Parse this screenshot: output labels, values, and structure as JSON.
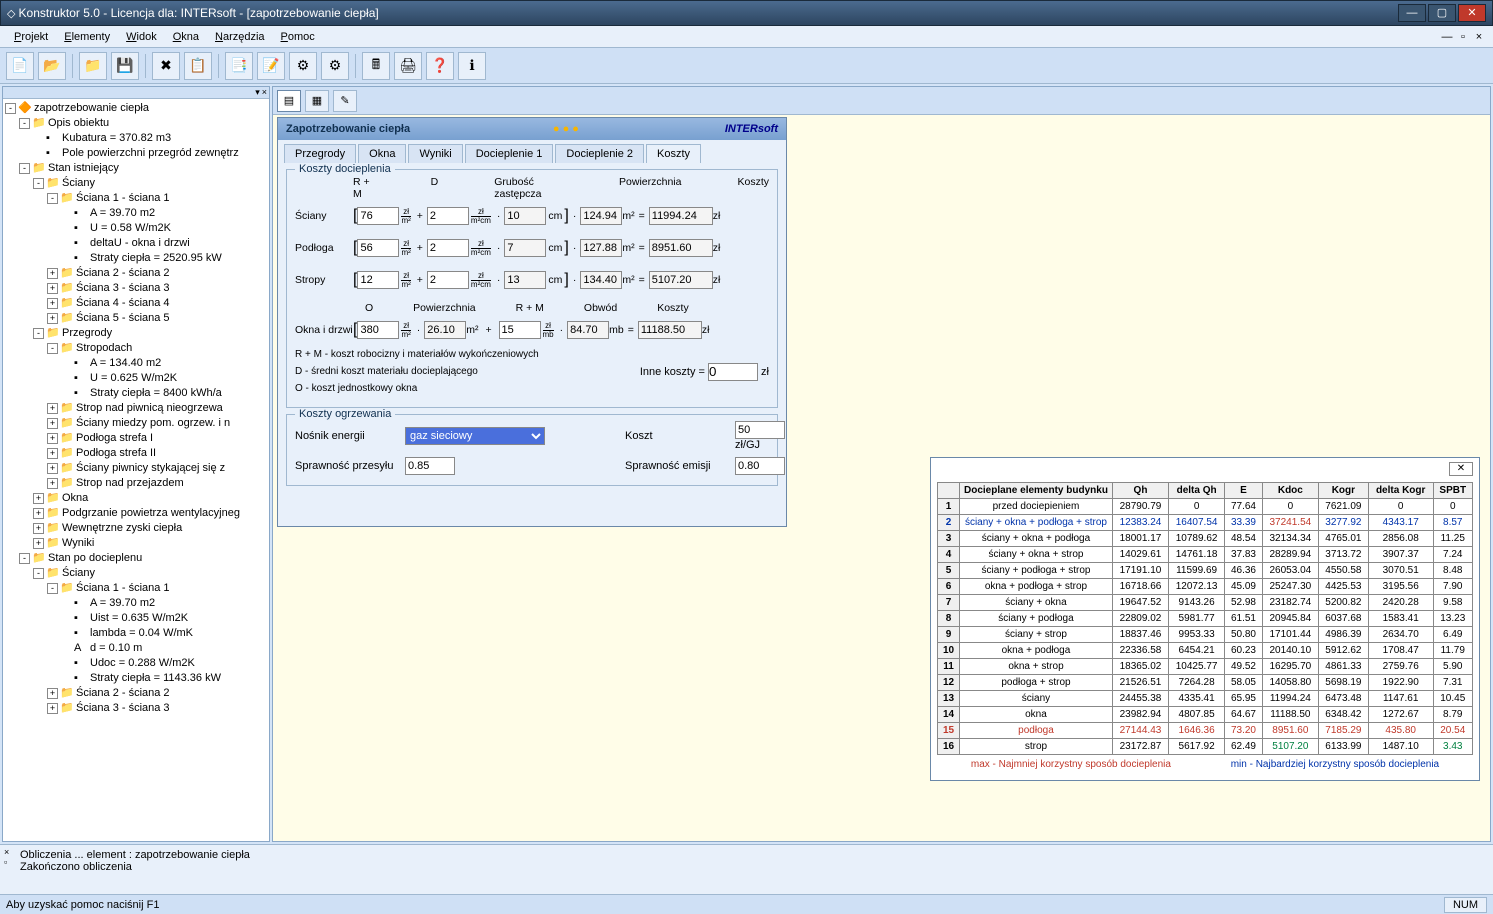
{
  "window": {
    "title": "Konstruktor 5.0 - Licencja dla: INTERsoft - [zapotrzebowanie ciepła]"
  },
  "menu": {
    "items": [
      "Projekt",
      "Elementy",
      "Widok",
      "Okna",
      "Narzędzia",
      "Pomoc"
    ]
  },
  "toolbar_icons": [
    "📄",
    "📂",
    "📁",
    "💾",
    "✖",
    "📋",
    "📑",
    "📝",
    "⚙",
    "⚙",
    "🖩",
    "🖨",
    "❓",
    "ℹ"
  ],
  "tree": [
    {
      "d": 0,
      "e": "-",
      "i": "🔶",
      "t": "zapotrzebowanie ciepła"
    },
    {
      "d": 1,
      "e": "-",
      "i": "📁",
      "t": "Opis obiektu"
    },
    {
      "d": 2,
      "e": "",
      "i": "▪",
      "t": "Kubatura = 370.82 m3"
    },
    {
      "d": 2,
      "e": "",
      "i": "▪",
      "t": "Pole powierzchni przegród zewnętrz"
    },
    {
      "d": 1,
      "e": "-",
      "i": "📁",
      "t": "Stan istniejący"
    },
    {
      "d": 2,
      "e": "-",
      "i": "📁",
      "t": "Ściany"
    },
    {
      "d": 3,
      "e": "-",
      "i": "📁",
      "t": "Ściana 1 - ściana 1"
    },
    {
      "d": 4,
      "e": "",
      "i": "▪",
      "t": "A = 39.70 m2"
    },
    {
      "d": 4,
      "e": "",
      "i": "▪",
      "t": "U = 0.58 W/m2K"
    },
    {
      "d": 4,
      "e": "",
      "i": "▪",
      "t": "deltaU - okna i drzwi"
    },
    {
      "d": 4,
      "e": "",
      "i": "▪",
      "t": "Straty ciepła = 2520.95 kW"
    },
    {
      "d": 3,
      "e": "+",
      "i": "📁",
      "t": "Ściana 2 - ściana 2"
    },
    {
      "d": 3,
      "e": "+",
      "i": "📁",
      "t": "Ściana 3 - ściana 3"
    },
    {
      "d": 3,
      "e": "+",
      "i": "📁",
      "t": "Ściana 4 - ściana 4"
    },
    {
      "d": 3,
      "e": "+",
      "i": "📁",
      "t": "Ściana 5 - ściana 5"
    },
    {
      "d": 2,
      "e": "-",
      "i": "📁",
      "t": "Przegrody"
    },
    {
      "d": 3,
      "e": "-",
      "i": "📁",
      "t": "Stropodach"
    },
    {
      "d": 4,
      "e": "",
      "i": "▪",
      "t": "A = 134.40 m2"
    },
    {
      "d": 4,
      "e": "",
      "i": "▪",
      "t": "U = 0.625 W/m2K"
    },
    {
      "d": 4,
      "e": "",
      "i": "▪",
      "t": "Straty ciepła = 8400 kWh/a"
    },
    {
      "d": 3,
      "e": "+",
      "i": "📁",
      "t": "Strop nad piwnicą nieogrzewa"
    },
    {
      "d": 3,
      "e": "+",
      "i": "📁",
      "t": "Ściany miedzy pom. ogrzew. i n"
    },
    {
      "d": 3,
      "e": "+",
      "i": "📁",
      "t": "Podłoga strefa I"
    },
    {
      "d": 3,
      "e": "+",
      "i": "📁",
      "t": "Podłoga strefa II"
    },
    {
      "d": 3,
      "e": "+",
      "i": "📁",
      "t": "Ściany piwnicy stykającej się z"
    },
    {
      "d": 3,
      "e": "+",
      "i": "📁",
      "t": "Strop nad przejazdem"
    },
    {
      "d": 2,
      "e": "+",
      "i": "📁",
      "t": "Okna"
    },
    {
      "d": 2,
      "e": "+",
      "i": "📁",
      "t": "Podgrzanie powietrza wentylacyjneg"
    },
    {
      "d": 2,
      "e": "+",
      "i": "📁",
      "t": "Wewnętrzne zyski ciepła"
    },
    {
      "d": 2,
      "e": "+",
      "i": "📁",
      "t": "Wyniki"
    },
    {
      "d": 1,
      "e": "-",
      "i": "📁",
      "t": "Stan po docieplenu"
    },
    {
      "d": 2,
      "e": "-",
      "i": "📁",
      "t": "Ściany"
    },
    {
      "d": 3,
      "e": "-",
      "i": "📁",
      "t": "Ściana 1 - ściana 1"
    },
    {
      "d": 4,
      "e": "",
      "i": "▪",
      "t": "A = 39.70 m2"
    },
    {
      "d": 4,
      "e": "",
      "i": "▪",
      "t": "Uist = 0.635 W/m2K"
    },
    {
      "d": 4,
      "e": "",
      "i": "▪",
      "t": "lambda = 0.04 W/mK"
    },
    {
      "d": 4,
      "e": "",
      "i": "A",
      "t": "d = 0.10 m"
    },
    {
      "d": 4,
      "e": "",
      "i": "▪",
      "t": "Udoc = 0.288 W/m2K"
    },
    {
      "d": 4,
      "e": "",
      "i": "▪",
      "t": "Straty ciepła = 1143.36 kW"
    },
    {
      "d": 3,
      "e": "+",
      "i": "📁",
      "t": "Ściana 2 - ściana 2"
    },
    {
      "d": 3,
      "e": "+",
      "i": "📁",
      "t": "Ściana 3 - ściana 3"
    }
  ],
  "form": {
    "title": "Zapotrzebowanie ciepła",
    "brand": "INTERsoft",
    "tabs": [
      "Przegrody",
      "Okna",
      "Wyniki",
      "Docieplenie 1",
      "Docieplenie 2",
      "Koszty"
    ],
    "active_tab": 5,
    "fs1": {
      "legend": "Koszty docieplenia",
      "hdr": [
        "R + M",
        "D",
        "Grubość zastępcza",
        "Powierzchnia",
        "Koszty"
      ],
      "rows": [
        {
          "lbl": "Ściany",
          "v1": "76",
          "v2": "2",
          "v3": "10",
          "v4": "124.94",
          "res": "11994.24"
        },
        {
          "lbl": "Podłoga",
          "v1": "56",
          "v2": "2",
          "v3": "7",
          "v4": "127.88",
          "res": "8951.60"
        },
        {
          "lbl": "Stropy",
          "v1": "12",
          "v2": "2",
          "v3": "13",
          "v4": "134.40",
          "res": "5107.20"
        }
      ],
      "hdr2": [
        "O",
        "Powierzchnia",
        "R + M",
        "Obwód",
        "Koszty"
      ],
      "row2": {
        "lbl": "Okna i drzwi",
        "v1": "380",
        "v2": "26.10",
        "v3": "15",
        "v4": "84.70",
        "res": "11188.50"
      },
      "notes": [
        "R + M - koszt robocizny i materiałów wykończeniowych",
        "D - średni koszt materiału docieplającego",
        "O - koszt jednostkowy okna"
      ],
      "inne": {
        "lbl": "Inne koszty",
        "v": "0"
      }
    },
    "fs2": {
      "legend": "Koszty ogrzewania",
      "lbl_nosnik": "Nośnik energii",
      "sel_nosnik": "gaz sieciowy",
      "lbl_koszt": "Koszt",
      "v_koszt": "50",
      "u_koszt": "zł/GJ",
      "lbl_sp": "Sprawność przesyłu",
      "v_sp": "0.85",
      "lbl_se": "Sprawność emisji",
      "v_se": "0.80"
    }
  },
  "table": {
    "cols": [
      "",
      "Docieplane elementy budynku",
      "Qh",
      "delta Qh",
      "E",
      "Kdoc",
      "Kogr",
      "delta Kogr",
      "SPBT"
    ],
    "rows": [
      [
        "1",
        "przed dociepieniem",
        "28790.79",
        "0",
        "77.64",
        "0",
        "7621.09",
        "0",
        "0"
      ],
      [
        "2",
        "ściany + okna + podłoga + strop",
        "12383.24",
        "16407.54",
        "33.39",
        "37241.54",
        "3277.92",
        "4343.17",
        "8.57"
      ],
      [
        "3",
        "ściany + okna + podłoga",
        "18001.17",
        "10789.62",
        "48.54",
        "32134.34",
        "4765.01",
        "2856.08",
        "11.25"
      ],
      [
        "4",
        "ściany + okna + strop",
        "14029.61",
        "14761.18",
        "37.83",
        "28289.94",
        "3713.72",
        "3907.37",
        "7.24"
      ],
      [
        "5",
        "ściany + podłoga + strop",
        "17191.10",
        "11599.69",
        "46.36",
        "26053.04",
        "4550.58",
        "3070.51",
        "8.48"
      ],
      [
        "6",
        "okna + podłoga + strop",
        "16718.66",
        "12072.13",
        "45.09",
        "25247.30",
        "4425.53",
        "3195.56",
        "7.90"
      ],
      [
        "7",
        "ściany + okna",
        "19647.52",
        "9143.26",
        "52.98",
        "23182.74",
        "5200.82",
        "2420.28",
        "9.58"
      ],
      [
        "8",
        "ściany + podłoga",
        "22809.02",
        "5981.77",
        "61.51",
        "20945.84",
        "6037.68",
        "1583.41",
        "13.23"
      ],
      [
        "9",
        "ściany + strop",
        "18837.46",
        "9953.33",
        "50.80",
        "17101.44",
        "4986.39",
        "2634.70",
        "6.49"
      ],
      [
        "10",
        "okna + podłoga",
        "22336.58",
        "6454.21",
        "60.23",
        "20140.10",
        "5912.62",
        "1708.47",
        "11.79"
      ],
      [
        "11",
        "okna + strop",
        "18365.02",
        "10425.77",
        "49.52",
        "16295.70",
        "4861.33",
        "2759.76",
        "5.90"
      ],
      [
        "12",
        "podłoga + strop",
        "21526.51",
        "7264.28",
        "58.05",
        "14058.80",
        "5698.19",
        "1922.90",
        "7.31"
      ],
      [
        "13",
        "ściany",
        "24455.38",
        "4335.41",
        "65.95",
        "11994.24",
        "6473.48",
        "1147.61",
        "10.45"
      ],
      [
        "14",
        "okna",
        "23982.94",
        "4807.85",
        "64.67",
        "11188.50",
        "6348.42",
        "1272.67",
        "8.79"
      ],
      [
        "15",
        "podłoga",
        "27144.43",
        "1646.36",
        "73.20",
        "8951.60",
        "7185.29",
        "435.80",
        "20.54"
      ],
      [
        "16",
        "strop",
        "23172.87",
        "5617.92",
        "62.49",
        "5107.20",
        "6133.99",
        "1487.10",
        "3.43"
      ]
    ],
    "row_class": {
      "2": "blue",
      "15": "red"
    },
    "cell_class": {
      "16": {
        "5": "green",
        "8": "green"
      },
      "2": {
        "5": "red"
      }
    },
    "footer": {
      "max": "max - Najmniej korzystny sposób docieplenia",
      "min": "min - Najbardziej korzystny sposób docieplenia"
    }
  },
  "log": {
    "l1": "Obliczenia ... element : zapotrzebowanie ciepła",
    "l2": "Zakończono obliczenia"
  },
  "status": {
    "help": "Aby uzyskać pomoc naciśnij F1",
    "num": "NUM"
  }
}
